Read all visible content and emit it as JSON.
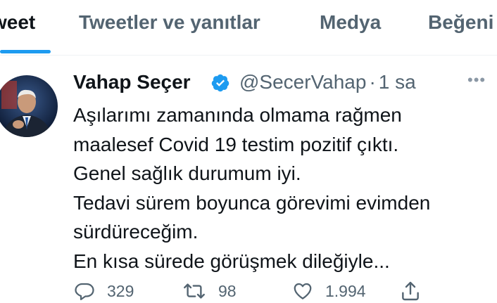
{
  "tabs": [
    {
      "label": "weet",
      "active": true
    },
    {
      "label": "Tweetler ve yanıtlar",
      "active": false
    },
    {
      "label": "Medya",
      "active": false
    },
    {
      "label": "Beğeni",
      "active": false
    }
  ],
  "tweet": {
    "author_name": "Vahap Seçer",
    "handle": "@SecerVahap",
    "separator": "·",
    "time": "1 sa",
    "verified": true,
    "lines": [
      "Aşılarımı zamanında olmama rağmen",
      "maalesef Covid 19 testim pozitif çıktı.",
      "Genel sağlık durumum iyi.",
      "Tedavi sürem boyunca görevimi evimden",
      "sürdüreceğim.",
      "En kısa sürede görüşmek dileğiyle..."
    ],
    "replies": "329",
    "retweets": "98",
    "likes": "1.994",
    "more_icon": "more-icon"
  },
  "colors": {
    "accent": "#1d9bf0",
    "text": "#0f1419",
    "muted": "#536471"
  }
}
